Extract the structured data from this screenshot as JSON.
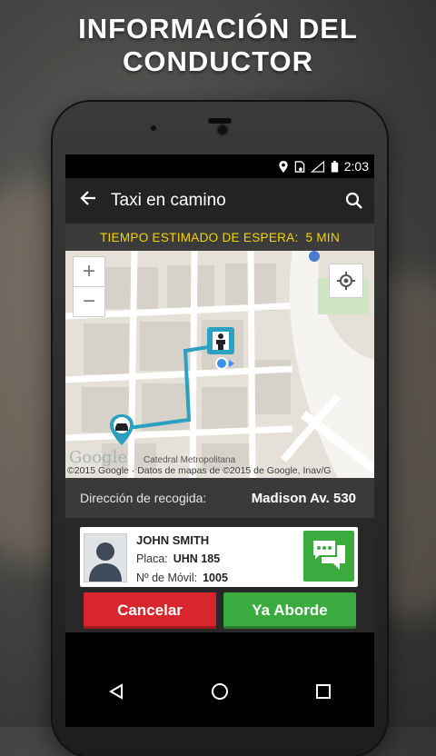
{
  "headline": {
    "line1": "INFORMACIÓN DEL",
    "line2": "CONDUCTOR"
  },
  "status_bar": {
    "time": "2:03",
    "icons": [
      "location-icon",
      "sim-icon",
      "signal-icon",
      "battery-icon"
    ]
  },
  "app_bar": {
    "title": "Taxi en camino",
    "back_icon": "arrow-left-icon",
    "search_icon": "search-icon"
  },
  "wait": {
    "label": "TIEMPO ESTIMADO DE ESPERA:",
    "value": "5 MIN",
    "color": "#f5d400"
  },
  "map": {
    "zoom_in": "+",
    "zoom_out": "−",
    "logo": "Google",
    "copyright": "©2015 Google · Datos de mapas de ©2015 de Google, Inav/G",
    "place_label": "Catedral Metropolitana",
    "route_color": "#2aa1c0"
  },
  "pickup": {
    "label": "Dirección de recogida:",
    "value": "Madison Av. 530"
  },
  "driver": {
    "name": "JOHN SMITH",
    "plate_label": "Placa:",
    "plate": "UHN 185",
    "mobile_label": "Nº de Móvil:",
    "mobile": "1005"
  },
  "actions": {
    "cancel": "Cancelar",
    "aboard": "Ya Aborde",
    "cancel_color": "#d8262d",
    "aboard_color": "#3cab3f"
  },
  "nav": {
    "back": "back-triangle-icon",
    "home": "home-circle-icon",
    "recents": "recents-square-icon"
  }
}
